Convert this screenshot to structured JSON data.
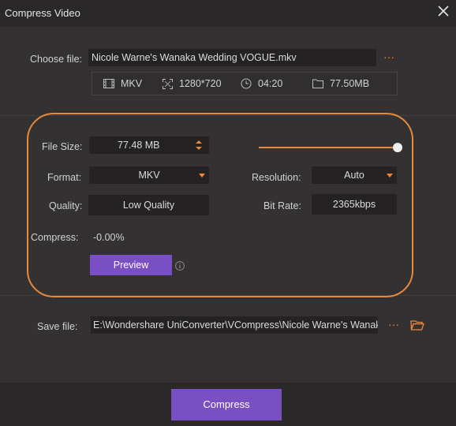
{
  "window": {
    "title": "Compress Video",
    "close_icon": "close-icon"
  },
  "source": {
    "label": "Choose file:",
    "file_name": "Nicole Warne's Wanaka Wedding  VOGUE.mkv",
    "more_label": "···",
    "info": {
      "format": "MKV",
      "resolution": "1280*720",
      "duration": "04:20",
      "size": "77.50MB"
    }
  },
  "settings": {
    "file_size_label": "File Size:",
    "file_size_value": "77.48  MB",
    "file_size_slider_percent": 100,
    "format_label": "Format:",
    "format_value": "MKV",
    "resolution_label": "Resolution:",
    "resolution_value": "Auto",
    "quality_label": "Quality:",
    "quality_value": "Low Quality",
    "bitrate_label": "Bit Rate:",
    "bitrate_value": "2365kbps",
    "compress_label": "Compress:",
    "compress_value": "-0.00%",
    "preview_label": "Preview",
    "accent_color": "#e98a3a",
    "button_color": "#7b4fc4"
  },
  "output": {
    "label": "Save file:",
    "path": "E:\\Wondershare UniConverter\\VCompress\\Nicole Warne's Wanaka",
    "more_label": "···"
  },
  "footer": {
    "compress_label": "Compress"
  }
}
